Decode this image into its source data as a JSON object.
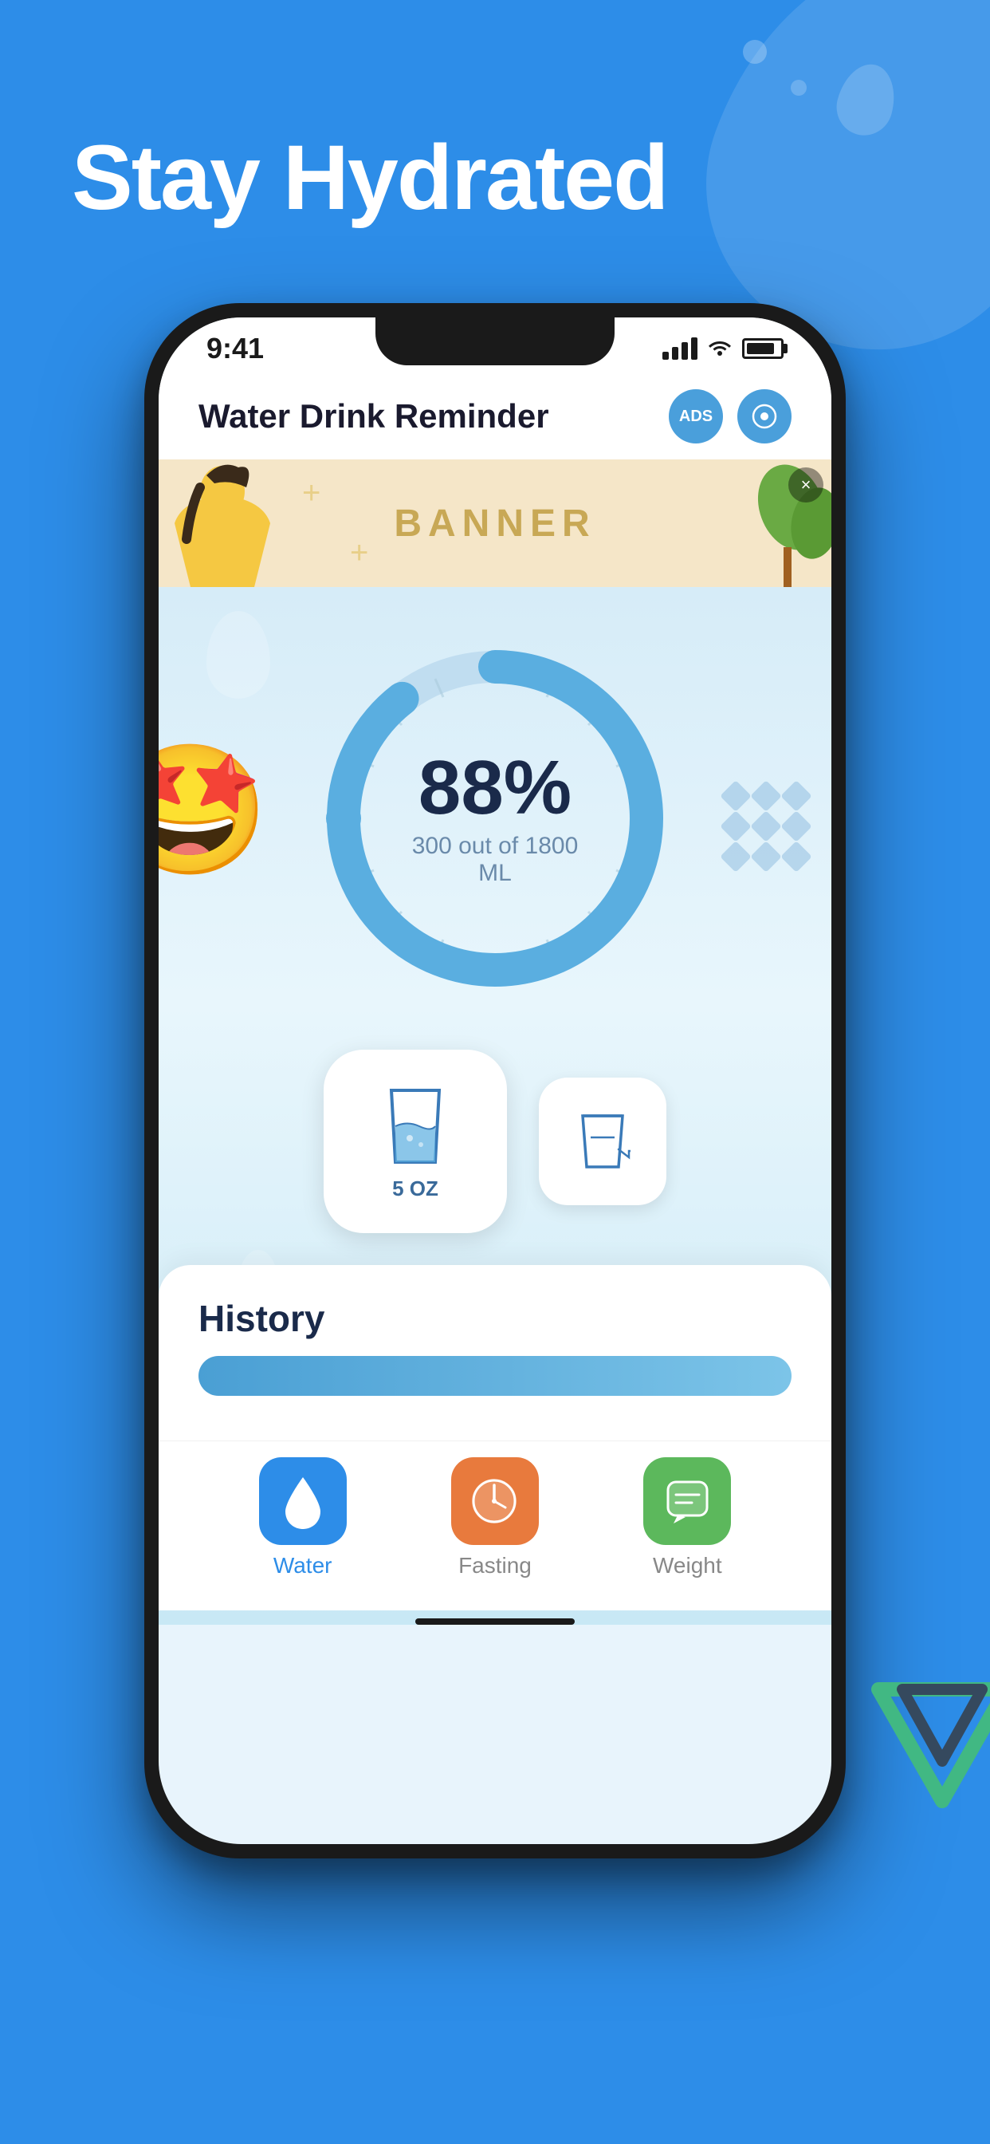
{
  "page": {
    "background_color": "#2d8de8",
    "title": "Stay Hydrated"
  },
  "status_bar": {
    "time": "9:41",
    "signal": "active",
    "wifi": "on",
    "battery": "full"
  },
  "app_header": {
    "title": "Water Drink Reminder",
    "ads_button": "ADS",
    "settings_button": "⚙"
  },
  "banner": {
    "text": "BANNER",
    "close": "×",
    "plus_symbol": "+"
  },
  "progress": {
    "percentage": "88%",
    "detail": "300 out of 1800 ML",
    "current": 300,
    "goal": 1800,
    "unit": "ML",
    "arc_progress": 0.88
  },
  "emoji": "🤩",
  "water_buttons": {
    "primary_label": "5\nOZ",
    "secondary_icon": "📋"
  },
  "history": {
    "title": "History"
  },
  "bottom_nav": {
    "items": [
      {
        "id": "water",
        "label": "Water",
        "active": true
      },
      {
        "id": "fasting",
        "label": "Fasting",
        "active": false
      },
      {
        "id": "weight",
        "label": "Weight",
        "active": false
      }
    ]
  },
  "decorations": {
    "diamonds": 9
  }
}
